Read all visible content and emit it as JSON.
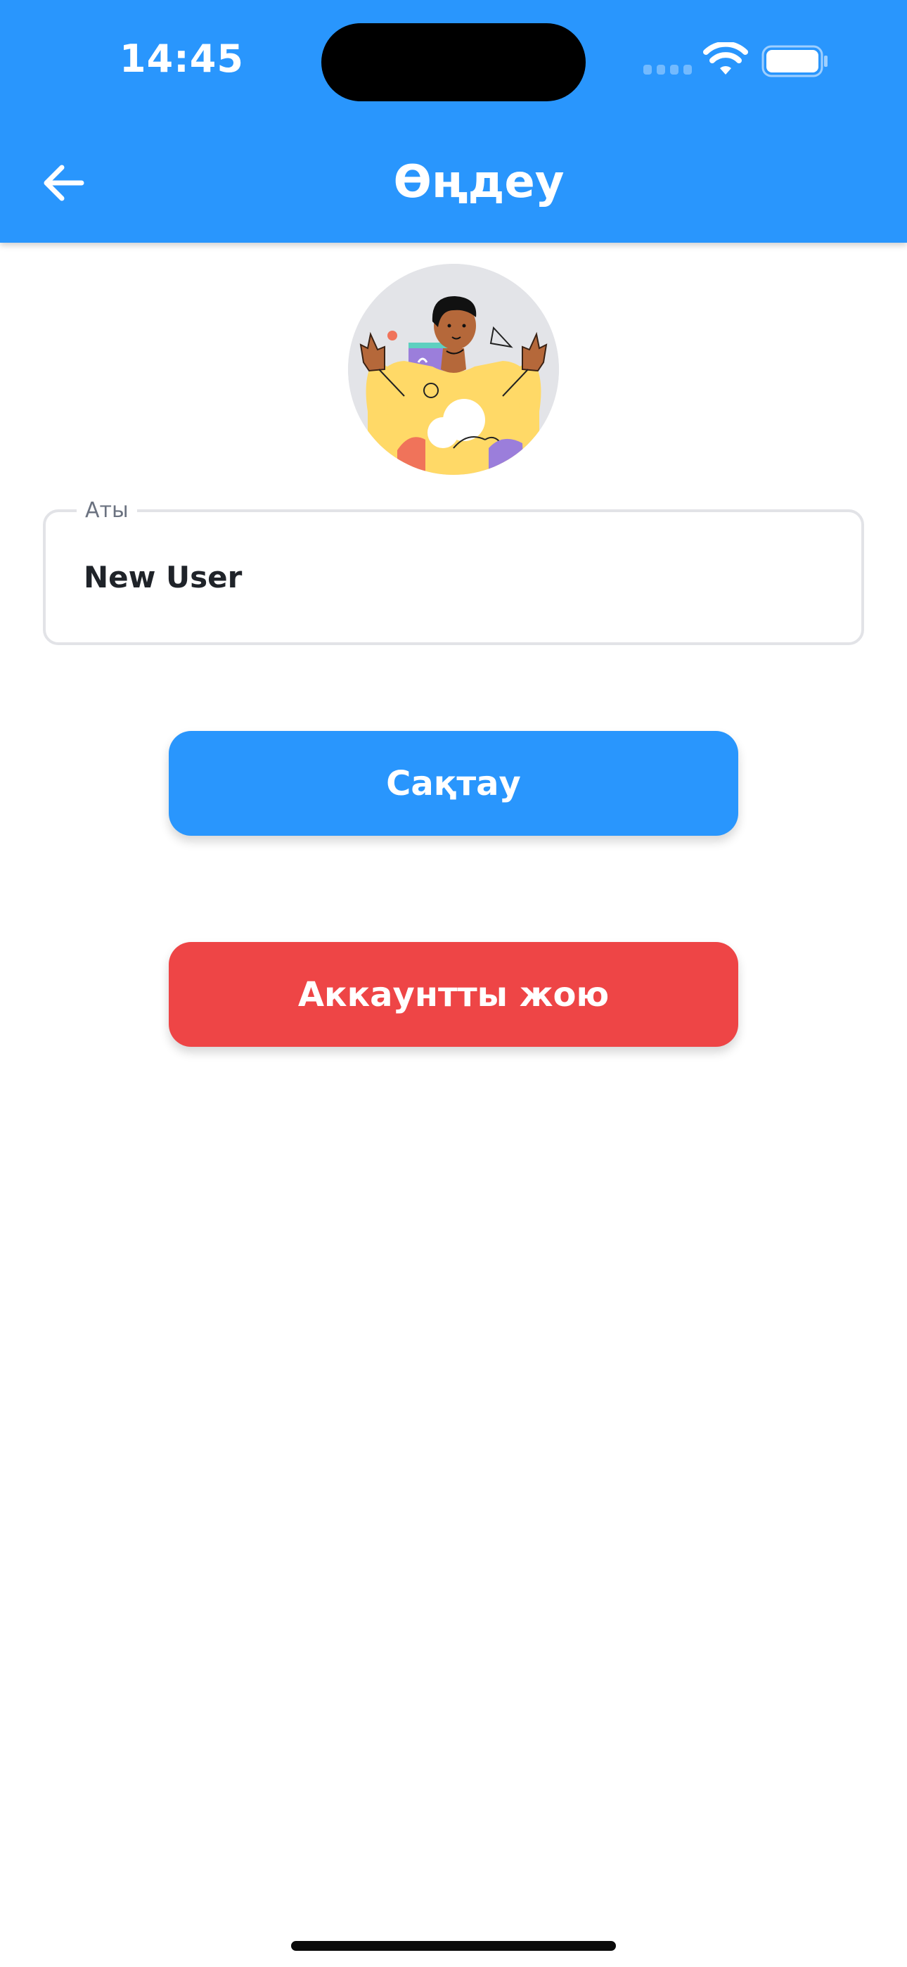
{
  "status_bar": {
    "time": "14:45"
  },
  "app_bar": {
    "title": "Өңдеу",
    "back_icon": "arrow-left-icon"
  },
  "profile": {
    "avatar_icon": "user-illustration-icon"
  },
  "form": {
    "name_label": "Аты",
    "name_value": "New User"
  },
  "actions": {
    "save_label": "Сақтау",
    "delete_label": "Аккаунтты жою"
  },
  "colors": {
    "primary": "#2996FD",
    "danger": "#EE4546",
    "background": "#FFFFFF",
    "field_border": "#E2E3E7",
    "text": "#1F2329"
  }
}
